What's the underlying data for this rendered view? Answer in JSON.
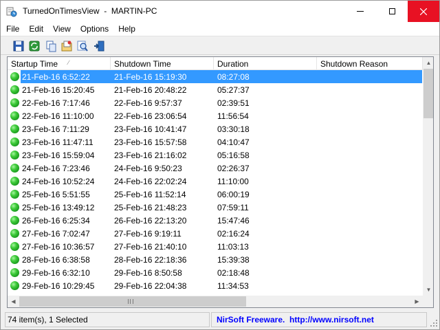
{
  "window": {
    "title": "TurnedOnTimesView  -  MARTIN-PC",
    "icons": [
      "app-icon",
      "minimize-icon",
      "maximize-icon",
      "close-icon"
    ]
  },
  "menu": [
    "File",
    "Edit",
    "View",
    "Options",
    "Help"
  ],
  "toolbar": {
    "buttons": [
      "save-icon",
      "refresh-icon",
      "copy-icon",
      "html-report-icon",
      "find-icon",
      "exit-icon"
    ]
  },
  "table": {
    "columns": [
      "Startup Time",
      "Shutdown Time",
      "Duration",
      "Shutdown Reason"
    ],
    "sort_indicator": "∕",
    "rows": [
      {
        "startup": "21-Feb-16 6:52:22",
        "shutdown": "21-Feb-16 15:19:30",
        "duration": "08:27:08",
        "reason": ""
      },
      {
        "startup": "21-Feb-16 15:20:45",
        "shutdown": "21-Feb-16 20:48:22",
        "duration": "05:27:37",
        "reason": ""
      },
      {
        "startup": "22-Feb-16 7:17:46",
        "shutdown": "22-Feb-16 9:57:37",
        "duration": "02:39:51",
        "reason": ""
      },
      {
        "startup": "22-Feb-16 11:10:00",
        "shutdown": "22-Feb-16 23:06:54",
        "duration": "11:56:54",
        "reason": ""
      },
      {
        "startup": "23-Feb-16 7:11:29",
        "shutdown": "23-Feb-16 10:41:47",
        "duration": "03:30:18",
        "reason": ""
      },
      {
        "startup": "23-Feb-16 11:47:11",
        "shutdown": "23-Feb-16 15:57:58",
        "duration": "04:10:47",
        "reason": ""
      },
      {
        "startup": "23-Feb-16 15:59:04",
        "shutdown": "23-Feb-16 21:16:02",
        "duration": "05:16:58",
        "reason": ""
      },
      {
        "startup": "24-Feb-16 7:23:46",
        "shutdown": "24-Feb-16 9:50:23",
        "duration": "02:26:37",
        "reason": ""
      },
      {
        "startup": "24-Feb-16 10:52:24",
        "shutdown": "24-Feb-16 22:02:24",
        "duration": "11:10:00",
        "reason": ""
      },
      {
        "startup": "25-Feb-16 5:51:55",
        "shutdown": "25-Feb-16 11:52:14",
        "duration": "06:00:19",
        "reason": ""
      },
      {
        "startup": "25-Feb-16 13:49:12",
        "shutdown": "25-Feb-16 21:48:23",
        "duration": "07:59:11",
        "reason": ""
      },
      {
        "startup": "26-Feb-16 6:25:34",
        "shutdown": "26-Feb-16 22:13:20",
        "duration": "15:47:46",
        "reason": ""
      },
      {
        "startup": "27-Feb-16 7:02:47",
        "shutdown": "27-Feb-16 9:19:11",
        "duration": "02:16:24",
        "reason": ""
      },
      {
        "startup": "27-Feb-16 10:36:57",
        "shutdown": "27-Feb-16 21:40:10",
        "duration": "11:03:13",
        "reason": ""
      },
      {
        "startup": "28-Feb-16 6:38:58",
        "shutdown": "28-Feb-16 22:18:36",
        "duration": "15:39:38",
        "reason": ""
      },
      {
        "startup": "29-Feb-16 6:32:10",
        "shutdown": "29-Feb-16 8:50:58",
        "duration": "02:18:48",
        "reason": ""
      },
      {
        "startup": "29-Feb-16 10:29:45",
        "shutdown": "29-Feb-16 22:04:38",
        "duration": "11:34:53",
        "reason": ""
      }
    ],
    "selected_index": 0
  },
  "status": {
    "items": "74 item(s), 1 Selected",
    "credit": "NirSoft Freeware.  http://www.nirsoft.net"
  },
  "colors": {
    "selection": "#3399ff",
    "close_button": "#e81123",
    "link": "#0000ff"
  }
}
